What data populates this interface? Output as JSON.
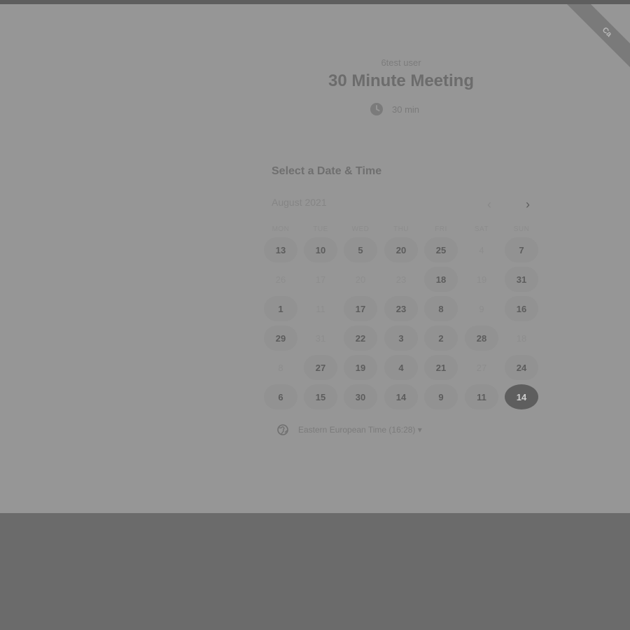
{
  "ribbon_text": "Ca",
  "host_name": "6test user",
  "event_title": "30 Minute Meeting",
  "duration": "30 min",
  "section_title": "Select a Date & Time",
  "calendar": {
    "month_label": "August 2021",
    "prev_label": "‹",
    "next_label": "›",
    "weekdays": [
      "MON",
      "TUE",
      "WED",
      "THU",
      "FRI",
      "SAT",
      "SUN"
    ],
    "weeks": [
      [
        {
          "d": "13",
          "s": "avail"
        },
        {
          "d": "10",
          "s": "avail"
        },
        {
          "d": "5",
          "s": "avail"
        },
        {
          "d": "20",
          "s": "avail"
        },
        {
          "d": "25",
          "s": "avail"
        },
        {
          "d": "4",
          "s": "muted"
        },
        {
          "d": "7",
          "s": "avail"
        }
      ],
      [
        {
          "d": "26",
          "s": "muted"
        },
        {
          "d": "17",
          "s": "muted"
        },
        {
          "d": "20",
          "s": "muted"
        },
        {
          "d": "23",
          "s": "muted"
        },
        {
          "d": "18",
          "s": "avail"
        },
        {
          "d": "19",
          "s": "muted"
        },
        {
          "d": "31",
          "s": "avail"
        }
      ],
      [
        {
          "d": "1",
          "s": "avail"
        },
        {
          "d": "11",
          "s": "muted"
        },
        {
          "d": "17",
          "s": "avail"
        },
        {
          "d": "23",
          "s": "avail"
        },
        {
          "d": "8",
          "s": "avail"
        },
        {
          "d": "9",
          "s": "muted"
        },
        {
          "d": "16",
          "s": "avail"
        }
      ],
      [
        {
          "d": "29",
          "s": "avail"
        },
        {
          "d": "31",
          "s": "muted"
        },
        {
          "d": "22",
          "s": "avail"
        },
        {
          "d": "3",
          "s": "avail"
        },
        {
          "d": "2",
          "s": "avail"
        },
        {
          "d": "28",
          "s": "avail"
        },
        {
          "d": "18",
          "s": "muted"
        }
      ],
      [
        {
          "d": "8",
          "s": "muted"
        },
        {
          "d": "27",
          "s": "avail"
        },
        {
          "d": "19",
          "s": "avail"
        },
        {
          "d": "4",
          "s": "avail"
        },
        {
          "d": "21",
          "s": "avail"
        },
        {
          "d": "27",
          "s": "muted"
        },
        {
          "d": "24",
          "s": "avail"
        }
      ],
      [
        {
          "d": "6",
          "s": "avail"
        },
        {
          "d": "15",
          "s": "avail"
        },
        {
          "d": "30",
          "s": "avail"
        },
        {
          "d": "14",
          "s": "avail"
        },
        {
          "d": "9",
          "s": "avail"
        },
        {
          "d": "11",
          "s": "avail"
        },
        {
          "d": "14",
          "s": "selected"
        }
      ]
    ]
  },
  "timezone": "Eastern European Time (16:28) ▾",
  "icons": {
    "duration": "clock-icon",
    "timezone": "globe-icon"
  }
}
